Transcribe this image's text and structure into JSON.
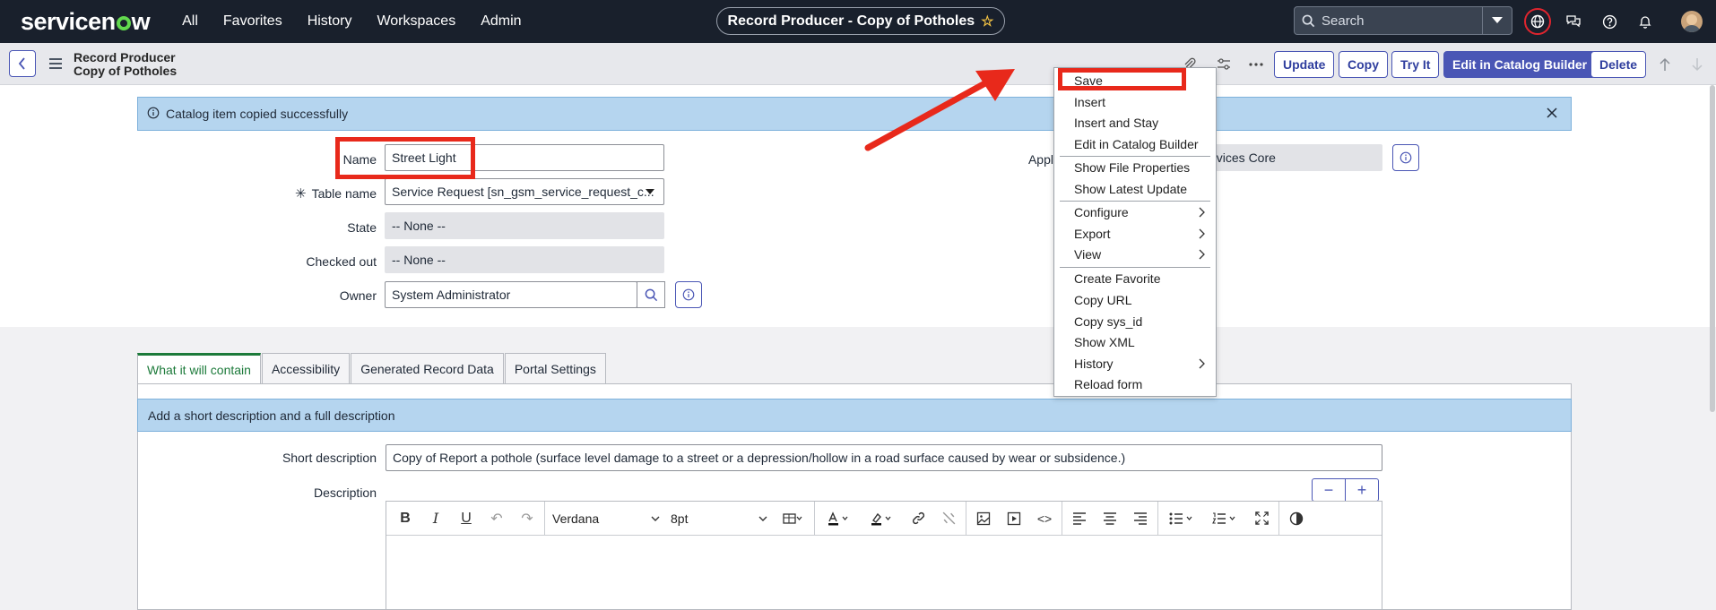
{
  "topnav": {
    "logo": "servicenow",
    "links": [
      "All",
      "Favorites",
      "History",
      "Workspaces",
      "Admin"
    ],
    "record_title": "Record Producer - Copy of Potholes",
    "search_placeholder": "Search"
  },
  "header": {
    "record_type": "Record Producer",
    "record_name": "Copy of Potholes",
    "buttons": {
      "update": "Update",
      "copy": "Copy",
      "try_it": "Try It",
      "edit_catalog_builder": "Edit in Catalog Builder",
      "delete": "Delete"
    }
  },
  "banner": {
    "message": "Catalog item copied successfully"
  },
  "form": {
    "name_label": "Name",
    "name_value": "Street Light",
    "table_label": "Table name",
    "table_value": "Service Request [sn_gsm_service_request_c...",
    "state_label": "State",
    "state_value": "-- None --",
    "checked_out_label": "Checked out",
    "checked_out_value": "-- None --",
    "owner_label": "Owner",
    "owner_value": "System Administrator",
    "application_label_partial": "Appl",
    "application_value_partial": "l Services Core"
  },
  "tabs": [
    "What it will contain",
    "Accessibility",
    "Generated Record Data",
    "Portal Settings"
  ],
  "section": {
    "heading": "Add a short description and a full description",
    "short_desc_label": "Short description",
    "short_desc_value": "Copy of Report a pothole (surface level damage to a street or a depression/hollow in a road surface caused by wear or subsidence.)",
    "desc_label": "Description",
    "font_family": "Verdana",
    "font_size": "8pt",
    "zoom_minus": "−",
    "zoom_plus": "+"
  },
  "context_menu": {
    "items": [
      {
        "label": "Save"
      },
      {
        "label": "Insert"
      },
      {
        "label": "Insert and Stay"
      },
      {
        "label": "Edit in Catalog Builder"
      },
      {
        "label": "Show File Properties"
      },
      {
        "label": "Show Latest Update"
      },
      {
        "label": "Configure"
      },
      {
        "label": "Export"
      },
      {
        "label": "View"
      },
      {
        "label": "Create Favorite"
      },
      {
        "label": "Copy URL"
      },
      {
        "label": "Copy sys_id"
      },
      {
        "label": "Show XML"
      },
      {
        "label": "History"
      },
      {
        "label": "Reload form"
      }
    ]
  },
  "colors": {
    "nav_bg": "#19202c",
    "primary": "#4a56b5",
    "banner_bg": "#b5d5ef",
    "annotation_red": "#e8291b",
    "tab_active": "#1c7a3a"
  }
}
